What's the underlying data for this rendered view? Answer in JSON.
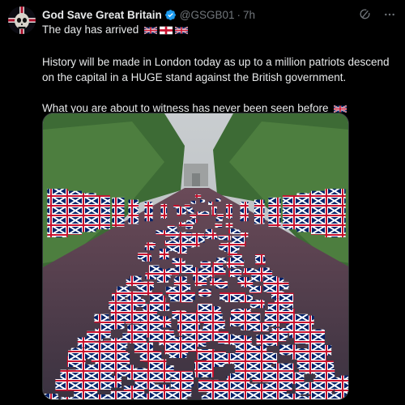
{
  "account": {
    "display_name": "God Save Great Britain",
    "handle": "@GSGB01",
    "separator": "·",
    "time": "7h",
    "verified": true
  },
  "tweet": {
    "line1": "The day has arrived",
    "line2": "History will be made in London today as up to a million patriots descend on the capital in a HUGE stand against the British government.",
    "line3": "What you are about to witness has never been seen before",
    "flags_line1": [
      "union-jack-flag",
      "england-flag",
      "union-jack-flag"
    ],
    "flags_line3": [
      "union-jack-flag"
    ]
  },
  "media": {
    "description_icon": "crowd-with-union-flags-photo"
  },
  "colors": {
    "background": "#000000",
    "text": "#e7e9ea",
    "muted": "#71767b",
    "verified": "#1d9bf0",
    "flag_blue": "#012169",
    "flag_red": "#c8102e"
  }
}
